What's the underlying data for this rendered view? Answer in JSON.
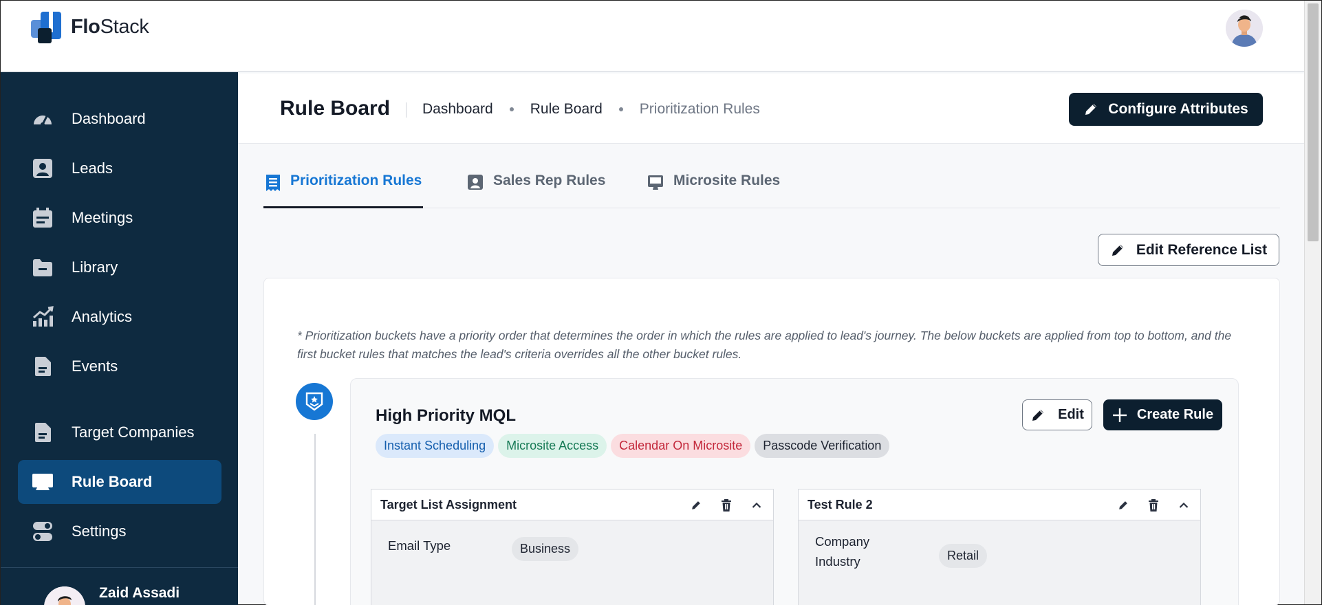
{
  "app": {
    "logo_text_bold": "Flo",
    "logo_text_regular": "Stack"
  },
  "sidebar": {
    "items": [
      {
        "label": "Dashboard",
        "icon": "gauge-icon"
      },
      {
        "label": "Leads",
        "icon": "user-card-icon"
      },
      {
        "label": "Meetings",
        "icon": "calendar-icon"
      },
      {
        "label": "Library",
        "icon": "folder-icon"
      },
      {
        "label": "Analytics",
        "icon": "trending-chart-icon"
      },
      {
        "label": "Events",
        "icon": "document-icon"
      },
      {
        "label": "Target Companies",
        "icon": "document-icon"
      },
      {
        "label": "Rule Board",
        "icon": "monitor-icon",
        "active": true
      },
      {
        "label": "Settings",
        "icon": "toggle-icon"
      }
    ],
    "user_name": "Zaid Assadi"
  },
  "header": {
    "title": "Rule Board",
    "breadcrumb": [
      "Dashboard",
      "Rule Board",
      "Prioritization Rules"
    ],
    "configure_button": "Configure Attributes"
  },
  "tabs": [
    {
      "label": "Prioritization Rules",
      "active": true
    },
    {
      "label": "Sales Rep Rules",
      "active": false
    },
    {
      "label": "Microsite Rules",
      "active": false
    }
  ],
  "edit_reference_button": "Edit Reference List",
  "note": "* Prioritization buckets have a priority order that determines the order in which the rules are applied to lead's journey. The below buckets are applied from top to bottom, and the first bucket rules that matches the lead's criteria overrides all the other bucket rules.",
  "bucket": {
    "title": "High Priority MQL",
    "chips": [
      "Instant Scheduling",
      "Microsite Access",
      "Calendar On Microsite",
      "Passcode Verification"
    ],
    "edit_button": "Edit",
    "create_button": "Create Rule",
    "rules": [
      {
        "title": "Target List Assignment",
        "conditions": [
          {
            "label": "Email Type",
            "value": "Business"
          }
        ]
      },
      {
        "title": "Test Rule 2",
        "conditions": [
          {
            "label": "Company Industry",
            "value": "Retail"
          }
        ]
      }
    ]
  },
  "colors": {
    "sidebar_bg": "#0e2a40",
    "sidebar_active": "#0d4a7c",
    "primary_dark": "#0c1f2f",
    "accent_blue": "#1777d4"
  }
}
